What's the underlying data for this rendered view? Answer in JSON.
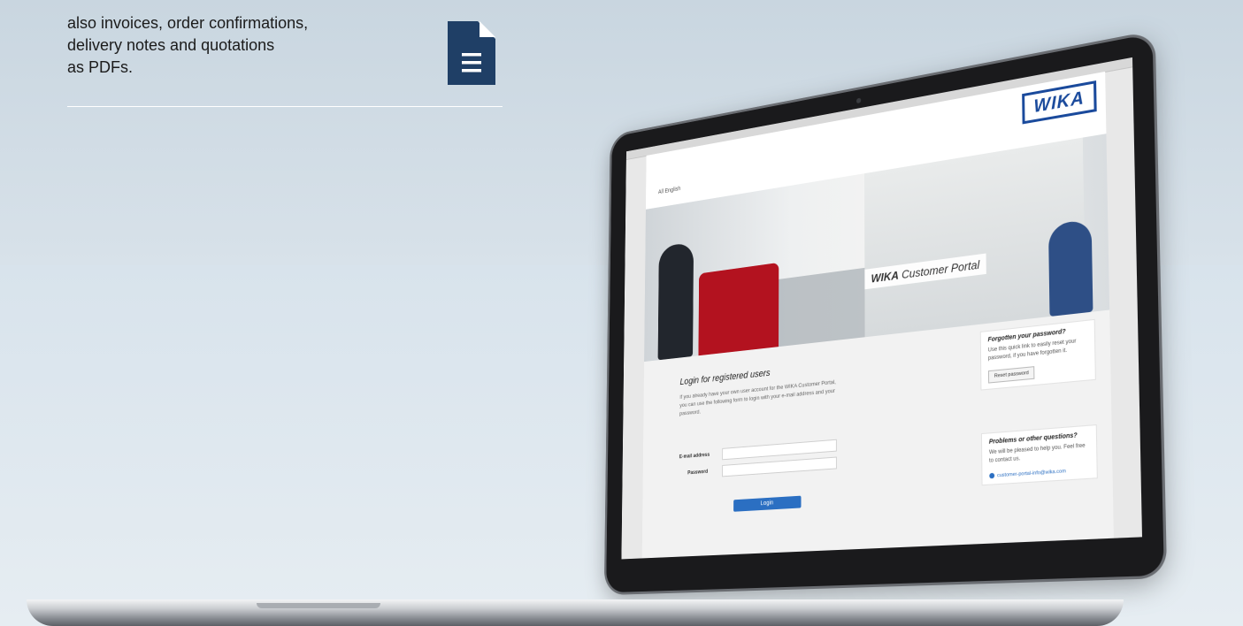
{
  "intro": {
    "lines": [
      "also invoices, order confirmations,",
      "delivery notes and quotations",
      "as PDFs."
    ],
    "icon": "document-icon",
    "icon_color": "#1f3f66"
  },
  "laptop_screen": {
    "brand": "WIKA",
    "brand_color": "#1a4a9c",
    "language_selector": "All English",
    "hero_badge": {
      "brand": "WIKA",
      "text": "Customer Portal"
    },
    "login": {
      "title": "Login for registered users",
      "description": "If you already have your own user account for the WIKA Customer Portal, you can use the following form to login with your e-mail address and your password.",
      "email_label": "E-mail address",
      "password_label": "Password",
      "button": "Login",
      "button_color": "#2b6fc2"
    },
    "forgot_box": {
      "title": "Forgotten your password?",
      "text": "Use this quick link to easily reset your password, if you have forgotten it.",
      "button": "Reset password"
    },
    "help_box": {
      "title": "Problems or other questions?",
      "text": "We will be pleased to help you. Feel free to contact us.",
      "email": "customer-portal-info@wika.com"
    }
  }
}
